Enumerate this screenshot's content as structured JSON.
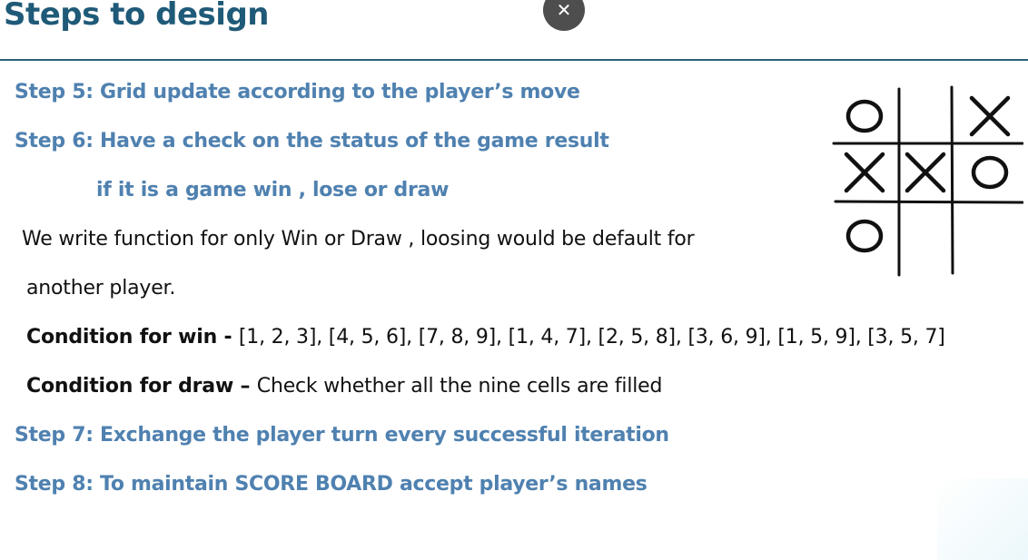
{
  "slide": {
    "title": "Steps to design",
    "close_icon": "close-icon",
    "close_glyph": "✕"
  },
  "content": {
    "step5": "Step 5: Grid update according to the player’s move",
    "step6": "Step 6: Have a check on the status of the game result",
    "step6_sub": "if it is a game win , lose or draw",
    "note_line1": "We write function for only Win or Draw , loosing would be default  for",
    "note_line2": "another player.",
    "win_label": "Condition for win - ",
    "win_value": "[1, 2, 3], [4, 5, 6], [7, 8, 9], [1, 4, 7], [2, 5, 8], [3, 6, 9], [1, 5, 9], [3, 5, 7]",
    "draw_label": "Condition for draw – ",
    "draw_value": "Check whether all the nine cells are filled",
    "step7": "Step 7: Exchange the player turn every successful iteration",
    "step8": "Step 8: To maintain SCORE BOARD accept player’s names"
  },
  "board": {
    "cells": [
      "O",
      "",
      "X",
      "X",
      "X",
      "O",
      "O",
      "",
      ""
    ]
  },
  "colors": {
    "title": "#1f5a78",
    "step": "#4f81b0",
    "rule": "#2e6377"
  }
}
